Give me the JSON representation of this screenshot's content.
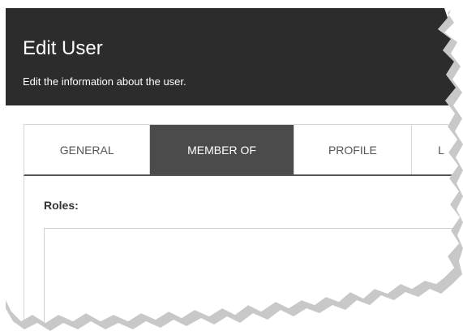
{
  "header": {
    "title": "Edit User",
    "subtitle": "Edit the information about the user."
  },
  "tabs": [
    {
      "label": "GENERAL",
      "active": false
    },
    {
      "label": "MEMBER OF",
      "active": true
    },
    {
      "label": "PROFILE",
      "active": false
    },
    {
      "label": "L",
      "active": false
    }
  ],
  "roles": {
    "label": "Roles:"
  },
  "colors": {
    "header_bg": "#2c2c2c",
    "active_tab_bg": "#4b4b4b",
    "tab_text": "#555555"
  }
}
